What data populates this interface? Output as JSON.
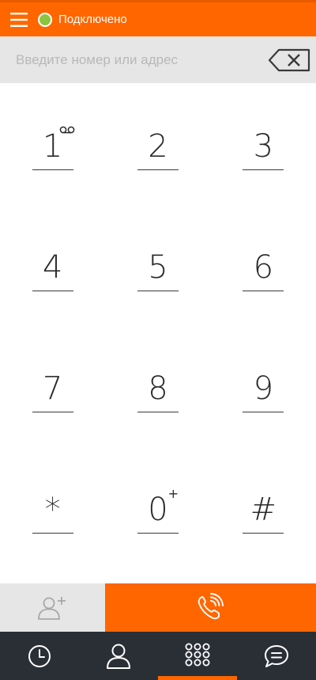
{
  "status": {
    "label": "Подключено",
    "color": "#8cc63f"
  },
  "address": {
    "placeholder": "Введите номер или адрес",
    "value": ""
  },
  "keypad": {
    "keys": [
      "1",
      "2",
      "3",
      "4",
      "5",
      "6",
      "7",
      "8",
      "9",
      "*",
      "0",
      "#"
    ],
    "zero_sup": "+"
  },
  "colors": {
    "accent": "#ff6600",
    "nav_bg": "#2a2f36",
    "bar_bg": "#e6e6e6"
  },
  "icons": {
    "menu": "menu-icon",
    "backspace": "backspace-icon",
    "voicemail": "voicemail-icon",
    "add_contact": "add-contact-icon",
    "call": "call-icon",
    "history": "clock-icon",
    "contacts": "person-icon",
    "dialpad": "dialpad-icon",
    "chat": "chat-icon"
  },
  "nav": {
    "active": "dialpad"
  }
}
